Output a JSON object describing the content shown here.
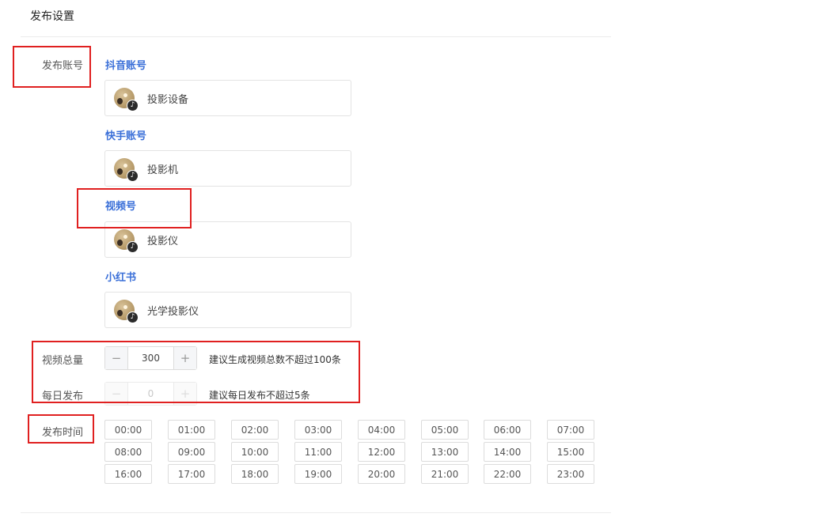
{
  "section_title": "发布设置",
  "labels": {
    "accounts": "发布账号",
    "video_total": "视频总量",
    "daily_publish": "每日发布",
    "publish_time": "发布时间"
  },
  "platforms": [
    {
      "name": "抖音账号",
      "account": "投影设备",
      "icon": "tiktok-icon"
    },
    {
      "name": "快手账号",
      "account": "投影机",
      "icon": "tiktok-icon"
    },
    {
      "name": "视频号",
      "account": "投影仪",
      "icon": "tiktok-icon"
    },
    {
      "name": "小红书",
      "account": "光学投影仪",
      "icon": "tiktok-icon"
    }
  ],
  "video_total": {
    "value": "300",
    "minus": "−",
    "plus": "+",
    "hint": "建议生成视频总数不超过100条"
  },
  "daily_publish": {
    "value": "0",
    "minus": "−",
    "plus": "+",
    "hint": "建议每日发布不超过5条",
    "disabled": true
  },
  "times": [
    "00:00",
    "01:00",
    "02:00",
    "03:00",
    "04:00",
    "05:00",
    "06:00",
    "07:00",
    "08:00",
    "09:00",
    "10:00",
    "11:00",
    "12:00",
    "13:00",
    "14:00",
    "15:00",
    "16:00",
    "17:00",
    "18:00",
    "19:00",
    "20:00",
    "21:00",
    "22:00",
    "23:00"
  ],
  "colors": {
    "platform_label": "#3a6fd8",
    "highlight_box": "#e02020"
  }
}
